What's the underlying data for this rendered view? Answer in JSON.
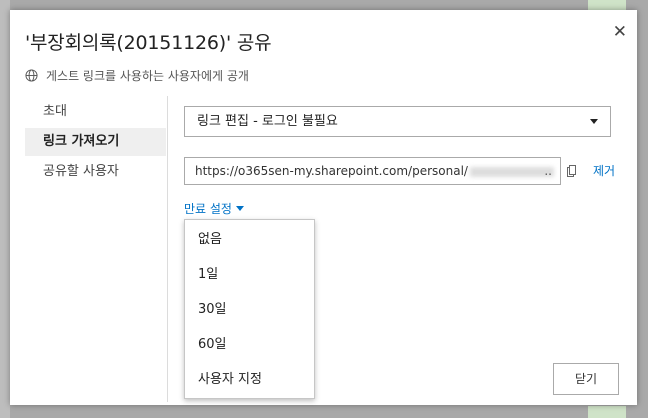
{
  "dialog": {
    "title": "'부장회의록(20151126)' 공유",
    "close_icon": "close-icon",
    "subtitle": "게스트 링크를 사용하는 사용자에게 공개",
    "subtitle_icon": "globe-icon"
  },
  "nav": {
    "items": [
      {
        "label": "초대",
        "active": false
      },
      {
        "label": "링크 가져오기",
        "active": true
      },
      {
        "label": "공유할 사용자",
        "active": false
      }
    ]
  },
  "link_type": {
    "selected": "링크 편집 - 로그인 불필요"
  },
  "link": {
    "url": "https://o365sen-my.sharepoint.com/personal/",
    "ellipsis": "..",
    "remove_label": "제거",
    "copy_icon": "copy-icon"
  },
  "expiry": {
    "label": "만료 설정",
    "options": [
      "없음",
      "1일",
      "30일",
      "60일",
      "사용자 지정"
    ]
  },
  "footer": {
    "close_label": "닫기"
  },
  "colors": {
    "link_blue": "#0072c6",
    "backdrop": "#a9a9a9"
  }
}
